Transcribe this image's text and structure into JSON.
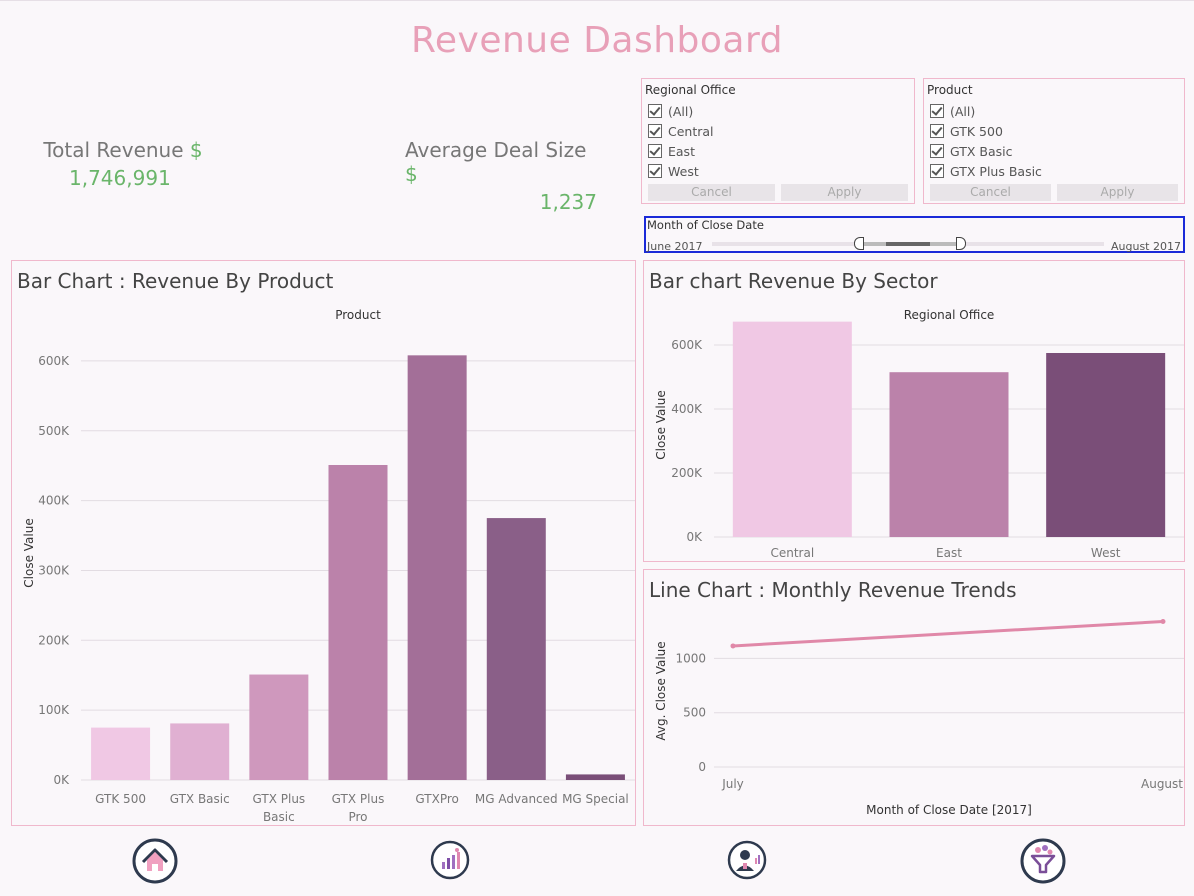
{
  "dashboard": {
    "title": "Revenue Dashboard"
  },
  "kpis": {
    "total_revenue": {
      "label": "Total Revenue",
      "currency": "$",
      "value": "1,746,991"
    },
    "avg_deal": {
      "label": "Average Deal Size",
      "currency": "$",
      "value": "1,237"
    }
  },
  "filters": {
    "regional": {
      "title": "Regional Office",
      "options": [
        "(All)",
        "Central",
        "East",
        "West"
      ],
      "checked": [
        true,
        true,
        true,
        true
      ],
      "cancel": "Cancel",
      "apply": "Apply"
    },
    "product": {
      "title": "Product",
      "options": [
        "(All)",
        "GTK 500",
        "GTX Basic",
        "GTX Plus Basic"
      ],
      "checked": [
        true,
        true,
        true,
        true
      ],
      "cancel": "Cancel",
      "apply": "Apply"
    }
  },
  "date_slider": {
    "title": "Month of Close Date",
    "min_label": "June 2017",
    "max_label": "August 2017"
  },
  "chart_data": [
    {
      "type": "bar",
      "title": "Bar Chart : Revenue By Product",
      "header": "Product",
      "ylabel": "Close Value",
      "categories": [
        "GTK 500",
        "GTX Basic",
        "GTX Plus Basic",
        "GTX Plus Pro",
        "GTXPro",
        "MG Advanced",
        "MG Special"
      ],
      "values": [
        75000,
        81000,
        151000,
        451000,
        608000,
        375000,
        8000
      ],
      "colors": [
        "#f0c8e4",
        "#e0b0d2",
        "#cf98bd",
        "#bb82aa",
        "#a36f98",
        "#8a5f88",
        "#7a4e78"
      ],
      "ylim": [
        0,
        650000
      ],
      "ticks": [
        0,
        100000,
        200000,
        300000,
        400000,
        500000,
        600000
      ],
      "tick_labels": [
        "0K",
        "100K",
        "200K",
        "300K",
        "400K",
        "500K",
        "600K"
      ],
      "grid": true
    },
    {
      "type": "bar",
      "title": "Bar chart Revenue By Sector",
      "header": "Regional Office",
      "ylabel": "Close Value",
      "categories": [
        "Central",
        "East",
        "West"
      ],
      "values": [
        673000,
        515000,
        575000
      ],
      "colors": [
        "#f0c8e4",
        "#bb82aa",
        "#7a4e78"
      ],
      "ylim": [
        0,
        700000
      ],
      "ticks": [
        0,
        200000,
        400000,
        600000
      ],
      "tick_labels": [
        "0K",
        "200K",
        "400K",
        "600K"
      ],
      "grid": true
    },
    {
      "type": "line",
      "title": "Line Chart : Monthly Revenue Trends",
      "ylabel": "Avg. Close Value",
      "xlabel": "Month of Close Date [2017]",
      "x": [
        "July",
        "August"
      ],
      "values": [
        1115,
        1340
      ],
      "color": "#e088a8",
      "ylim": [
        0,
        1400
      ],
      "ticks": [
        0,
        500,
        1000
      ],
      "tick_labels": [
        "0",
        "500",
        "1000"
      ],
      "grid": true
    }
  ],
  "nav": [
    {
      "name": "home",
      "icon": "home-icon"
    },
    {
      "name": "analytics",
      "icon": "analytics-icon"
    },
    {
      "name": "sales-rep",
      "icon": "sales-rep-icon"
    },
    {
      "name": "funnel",
      "icon": "funnel-icon"
    }
  ]
}
